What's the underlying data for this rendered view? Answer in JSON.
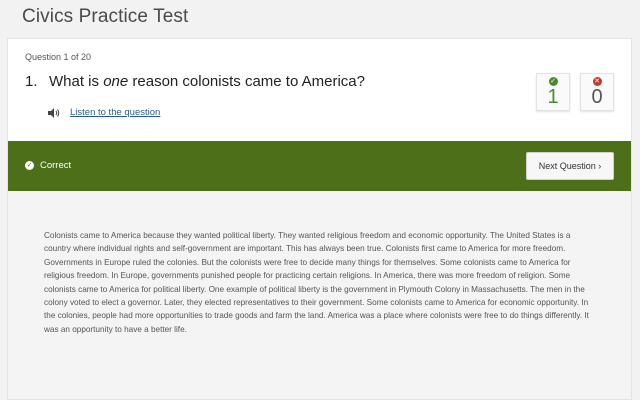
{
  "app": {
    "title": "Civics Practice Test"
  },
  "question": {
    "counter": "Question 1 of 20",
    "number": "1.",
    "text_before": "What is ",
    "text_emphasis": "one",
    "text_after": " reason colonists came to America?",
    "listen_label": "Listen to the question"
  },
  "score": {
    "correct_count": "1",
    "incorrect_count": "0",
    "correct_color": "#4a8a2e",
    "incorrect_color": "#c0392b"
  },
  "result": {
    "status": "Correct",
    "banner_color": "#4e6f1a",
    "next_button": "Next Question ›"
  },
  "explanation": {
    "text": "Colonists came to America because they wanted political liberty. They wanted religious freedom and economic opportunity. The United States is a country where individual rights and self-government are important. This has always been true. Colonists first came to America for more freedom. Governments in Europe ruled the colonies. But the colonists were free to decide many things for themselves. Some colonists came to America for religious freedom. In Europe, governments punished people for practicing certain religions. In America, there was more freedom of religion. Some colonists came to America for political liberty. One example of political liberty is the government in Plymouth Colony in Massachusetts. The men in the colony voted to elect a governor. Later, they elected representatives to their government. Some colonists came to America for economic opportunity. In the colonies, people had more opportunities to trade goods and farm the land. America was a place where colonists were free to do things differently. It was an opportunity to have a better life."
  },
  "icons": {
    "speaker": "speaker-icon",
    "check": "check-icon",
    "cross": "cross-icon"
  }
}
